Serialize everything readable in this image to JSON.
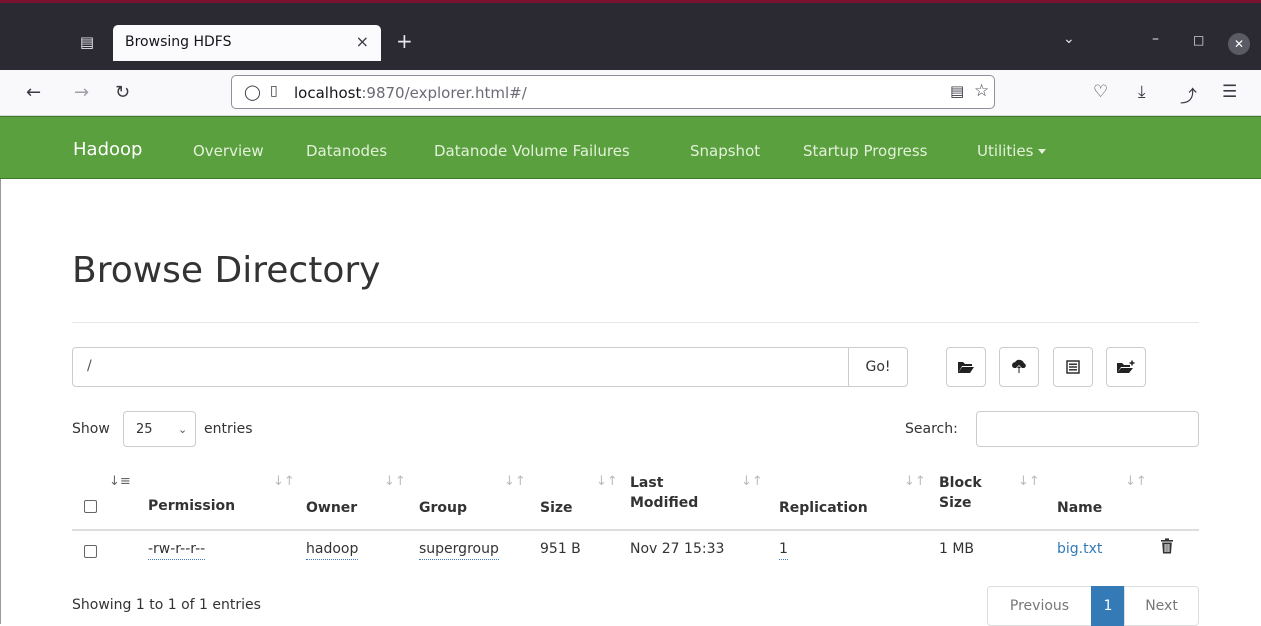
{
  "browser": {
    "tab_title": "Browsing HDFS",
    "tab_close": "×",
    "new_tab": "+",
    "url_host": "localhost",
    "url_rest": ":9870/explorer.html#/",
    "icons": [
      "tab-list-icon",
      "back-icon",
      "forward-icon",
      "reload-icon",
      "shield-icon",
      "page-icon",
      "reader-view-icon",
      "bookmark-star-icon",
      "pocket-icon",
      "download-icon",
      "extensions-icon",
      "menu-icon",
      "chevron-down-icon",
      "minimize-icon",
      "maximize-icon",
      "close-icon"
    ]
  },
  "hadoop_nav": {
    "brand": "Hadoop",
    "links": [
      "Overview",
      "Datanodes",
      "Datanode Volume Failures",
      "Snapshot",
      "Startup Progress",
      "Utilities"
    ]
  },
  "page": {
    "title": "Browse Directory",
    "path_value": "/",
    "go_label": "Go!",
    "action_icons": [
      "folder-open-icon",
      "upload-cloud-icon",
      "list-icon",
      "create-directory-icon"
    ]
  },
  "table_controls": {
    "show_label": "Show",
    "page_length": "25",
    "entries_label": "entries",
    "search_label": "Search:"
  },
  "table": {
    "headers": [
      {
        "line1": "Permission",
        "line2": ""
      },
      {
        "line1": "Owner",
        "line2": ""
      },
      {
        "line1": "Group",
        "line2": ""
      },
      {
        "line1": "Size",
        "line2": ""
      },
      {
        "line1": "Last",
        "line2": "Modified"
      },
      {
        "line1": "Replication",
        "line2": ""
      },
      {
        "line1": "Block",
        "line2": "Size"
      },
      {
        "line1": "Name",
        "line2": ""
      }
    ],
    "rows": [
      {
        "permission": "-rw-r--r--",
        "owner": "hadoop",
        "group": "supergroup",
        "size": "951 B",
        "last_modified": "Nov 27 15:33",
        "replication": "1",
        "block_size": "1 MB",
        "name": "big.txt"
      }
    ]
  },
  "footer": {
    "info": "Showing 1 to 1 of 1 entries",
    "previous": "Previous",
    "current_page": "1",
    "next": "Next"
  },
  "colors": {
    "hadoop_green": "#5aa03f",
    "link_blue": "#337ab7",
    "titlebar": "#2b2a33"
  }
}
